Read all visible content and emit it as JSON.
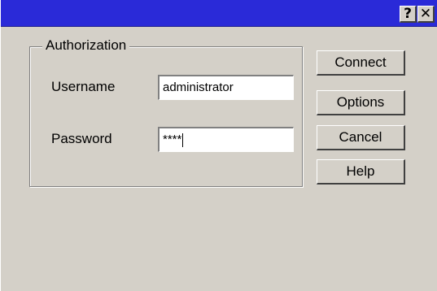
{
  "titlebar": {
    "help_label": "?",
    "close_label": "✕",
    "accent_color": "#2a2ad8"
  },
  "authorization": {
    "group_title": "Authorization",
    "username_label": "Username",
    "username_value": "administrator",
    "password_label": "Password",
    "password_value": "****"
  },
  "buttons": {
    "connect": "Connect",
    "options": "Options",
    "cancel": "Cancel",
    "help": "Help"
  }
}
